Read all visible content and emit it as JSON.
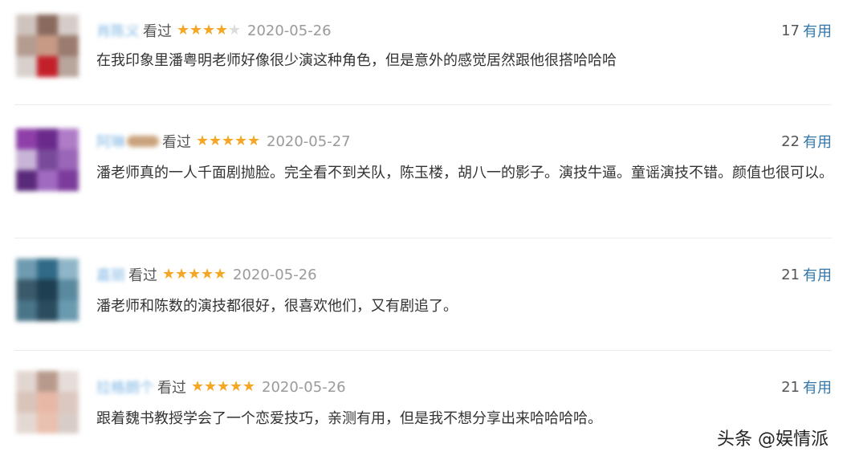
{
  "comments": [
    {
      "username": "肖陈义",
      "status": "看过",
      "rating": 4,
      "date": "2020-05-26",
      "votes": "17",
      "vote_label": "有用",
      "text": "在我印象里潘粤明老师好像很少演这种角色，但是意外的感觉居然跟他很搭哈哈哈"
    },
    {
      "username": "阿琳",
      "status": "看过",
      "rating": 5,
      "date": "2020-05-27",
      "votes": "22",
      "vote_label": "有用",
      "text": "潘老师真的一人千面剧抛脸。完全看不到关队，陈玉楼，胡八一的影子。演技牛逼。童谣演技不错。颜值也很可以。"
    },
    {
      "username": "嘉丽",
      "status": "看过",
      "rating": 5,
      "date": "2020-05-26",
      "votes": "21",
      "vote_label": "有用",
      "text": "潘老师和陈数的演技都很好，很喜欢他们，又有剧追了。"
    },
    {
      "username": "拉格朗个",
      "status": "看过",
      "rating": 5,
      "date": "2020-05-26",
      "votes": "21",
      "vote_label": "有用",
      "text": "跟着魏书教授学会了一个恋爱技巧，亲测有用，但是我不想分享出来哈哈哈哈。"
    }
  ],
  "watermark": "头条 @娱情派",
  "colors": {
    "star_on": "#f5a623",
    "star_off": "#dcdcdc",
    "link": "#3377aa",
    "username": "#7fb7e4"
  }
}
